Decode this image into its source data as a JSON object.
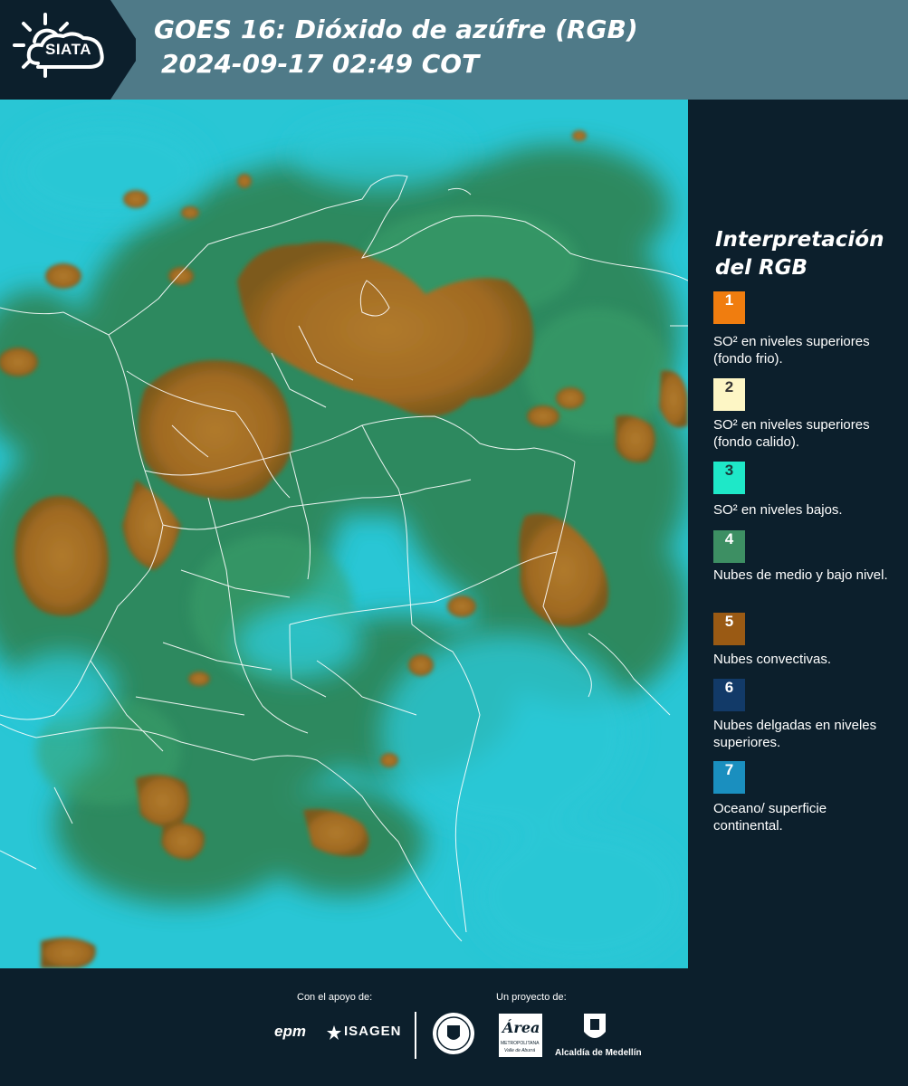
{
  "header": {
    "brand": "SIATA",
    "title_line1": "GOES 16: Dióxido de azúfre (RGB)",
    "title_line2": "2024-09-17 02:49 COT"
  },
  "legend": {
    "title_line1": "Interpretación",
    "title_line2": "del RGB",
    "items": [
      {
        "number": "1",
        "color": "#f07d0f",
        "text_color": "#ffffff",
        "label": "SO² en niveles superiores (fondo frio)."
      },
      {
        "number": "2",
        "color": "#fdf6c5",
        "text_color": "#333333",
        "label": "SO² en niveles superiores (fondo calido)."
      },
      {
        "number": "3",
        "color": "#1ee8c8",
        "text_color": "#1a3a3a",
        "label": "SO² en niveles bajos."
      },
      {
        "number": "4",
        "color": "#3d8f63",
        "text_color": "#ffffff",
        "label": "Nubes de medio y bajo nivel."
      },
      {
        "number": "5",
        "color": "#9a5a14",
        "text_color": "#ffffff",
        "label": "Nubes convectivas."
      },
      {
        "number": "6",
        "color": "#123a68",
        "text_color": "#ffffff",
        "label": "Nubes delgadas en niveles superiores."
      },
      {
        "number": "7",
        "color": "#1a8fbf",
        "text_color": "#ffffff",
        "label": "Oceano/ superficie continental."
      }
    ]
  },
  "footer": {
    "support_label": "Con el apoyo de:",
    "project_label": "Un proyecto de:",
    "sponsor_1": "epm",
    "sponsor_2": "ISAGEN",
    "partner_area_1": "Área",
    "partner_area_2": "METROPOLITANA",
    "partner_area_3": "Valle de Aburrá",
    "partner_alcaldia": "Alcaldía de Medellín"
  },
  "colors": {
    "panel_background": "#0c1f2c",
    "header_band": "#4f7a88",
    "ocean_cyan": "#24c3d2",
    "convective_brown": "#a8722a",
    "vegetation_green": "#2e7d48"
  }
}
